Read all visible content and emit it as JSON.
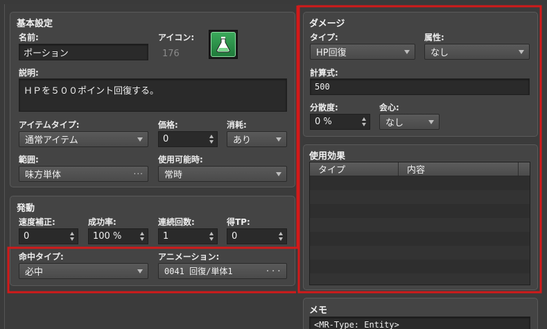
{
  "basic": {
    "title": "基本設定",
    "name_label": "名前:",
    "name_value": "ポーション",
    "icon_label": "アイコン:",
    "icon_index": "176",
    "description_label": "説明:",
    "description_value": "ＨＰを５００ポイント回復する。",
    "item_type_label": "アイテムタイプ:",
    "item_type_value": "通常アイテム",
    "price_label": "価格:",
    "price_value": "0",
    "consume_label": "消耗:",
    "consume_value": "あり",
    "scope_label": "範囲:",
    "scope_value": "味方単体",
    "occasion_label": "使用可能時:",
    "occasion_value": "常時"
  },
  "invocation": {
    "title": "発動",
    "speed_label": "速度補正:",
    "speed_value": "0",
    "success_label": "成功率:",
    "success_value": "100 %",
    "repeat_label": "連続回数:",
    "repeat_value": "1",
    "tp_label": "得TP:",
    "tp_value": "0",
    "hit_type_label": "命中タイプ:",
    "hit_type_value": "必中",
    "animation_label": "アニメーション:",
    "animation_value": "0041 回復/単体1"
  },
  "damage": {
    "title": "ダメージ",
    "type_label": "タイプ:",
    "type_value": "HP回復",
    "element_label": "属性:",
    "element_value": "なし",
    "formula_label": "計算式:",
    "formula_value": "500",
    "variance_label": "分散度:",
    "variance_value": "0 %",
    "critical_label": "会心:",
    "critical_value": "なし"
  },
  "effects": {
    "title": "使用効果",
    "columns": [
      "タイプ",
      "内容"
    ]
  },
  "memo": {
    "title": "メモ",
    "value": "<MR-Type: Entity>"
  },
  "colors": {
    "highlight": "#d21a1a",
    "panel": "#444444",
    "field": "#2a2a2a"
  }
}
